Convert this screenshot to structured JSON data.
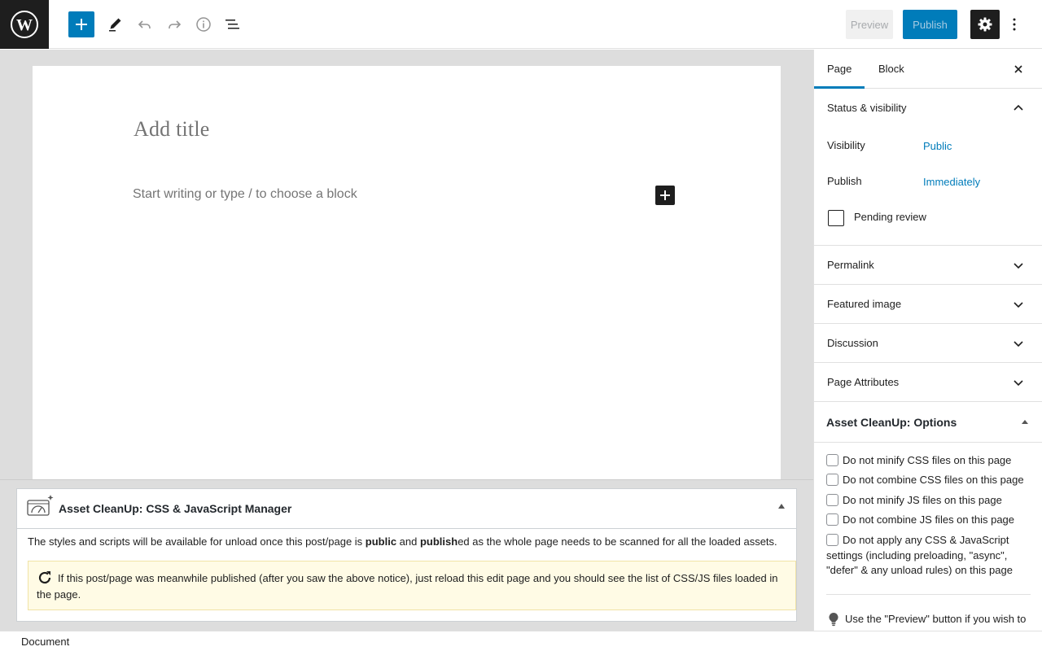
{
  "toolbar": {
    "logo_icon": "wordpress-icon",
    "add_block_icon": "plus-icon",
    "tools_icon": "pencil-icon",
    "undo_icon": "undo-icon",
    "redo_icon": "redo-icon",
    "details_icon": "info-icon",
    "outline_icon": "list-view-icon",
    "preview_label": "Preview",
    "publish_label": "Publish",
    "settings_icon": "gear-icon",
    "more_icon": "kebab-icon"
  },
  "editor": {
    "title_placeholder": "Add title",
    "body_placeholder": "Start writing or type / to choose a block"
  },
  "metabox": {
    "title": "Asset CleanUp: CSS & JavaScript Manager",
    "notice_pre": "The styles and scripts will be available for unload once this post/page is ",
    "notice_b1": "public",
    "notice_mid": " and ",
    "notice_b2": "publish",
    "notice_post": "ed as the whole page needs to be scanned for all the loaded assets.",
    "warning": "If this post/page was meanwhile published (after you saw the above notice), just reload this edit page and you should see the list of CSS/JS files loaded in the page."
  },
  "statusbar": {
    "breadcrumb": "Document"
  },
  "sidebar": {
    "tabs": [
      {
        "label": "Page",
        "active": true
      },
      {
        "label": "Block",
        "active": false
      }
    ],
    "status_visibility": {
      "title": "Status & visibility",
      "visibility_label": "Visibility",
      "visibility_value": "Public",
      "publish_label": "Publish",
      "publish_value": "Immediately",
      "pending_label": "Pending review",
      "pending_checked": false
    },
    "panels": [
      {
        "label": "Permalink"
      },
      {
        "label": "Featured image"
      },
      {
        "label": "Discussion"
      },
      {
        "label": "Page Attributes"
      }
    ],
    "asset_cleanup": {
      "title": "Asset CleanUp: Options",
      "options": [
        {
          "label": "Do not minify CSS files on this page",
          "checked": false
        },
        {
          "label": "Do not combine CSS files on this page",
          "checked": false
        },
        {
          "label": "Do not minify JS files on this page",
          "checked": false
        },
        {
          "label": "Do not combine JS files on this page",
          "checked": false
        },
        {
          "label": "Do not apply any CSS & JavaScript settings (including preloading, \"async\", \"defer\" & any unload rules) on this page",
          "checked": false
        }
      ],
      "tip": "Use the \"Preview\" button if you wish to"
    }
  },
  "colors": {
    "accent": "#007cba",
    "dark": "#1e1e1e",
    "editor_bg": "#dddddd",
    "notice_bg": "#fffbe5"
  }
}
